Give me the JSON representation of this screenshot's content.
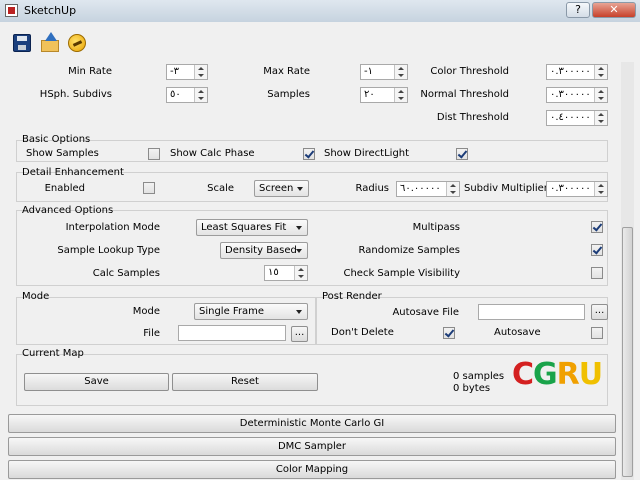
{
  "window": {
    "title": "SketchUp",
    "help_label": "?",
    "close_label": "✕"
  },
  "toolbar": {
    "save_icon": "save-icon",
    "open_icon": "open-folder-icon",
    "render_icon": "render-icon"
  },
  "top_params": {
    "min_rate_label": "Min Rate",
    "min_rate_value": "-٣",
    "max_rate_label": "Max Rate",
    "max_rate_value": "-١",
    "color_threshold_label": "Color Threshold",
    "color_threshold_value": "٠.٣٠٠٠٠٠",
    "hsph_label": "HSph. Subdivs",
    "hsph_value": "٥٠",
    "samples_label": "Samples",
    "samples_value": "٢٠",
    "normal_threshold_label": "Normal Threshold",
    "normal_threshold_value": "٠.٣٠٠٠٠٠",
    "dist_threshold_label": "Dist Threshold",
    "dist_threshold_value": "٠.٤٠٠٠٠٠"
  },
  "basic": {
    "title": "Basic Options",
    "show_samples_label": "Show Samples",
    "show_samples_checked": false,
    "show_calc_phase_label": "Show Calc Phase",
    "show_calc_phase_checked": true,
    "show_directlight_label": "Show DirectLight",
    "show_directlight_checked": true
  },
  "detail": {
    "title": "Detail Enhancement",
    "enabled_label": "Enabled",
    "enabled_checked": false,
    "scale_label": "Scale",
    "scale_value": "Screen",
    "radius_label": "Radius",
    "radius_value": "٦٠.٠٠٠٠٠",
    "subdiv_mult_label": "Subdiv Multiplier",
    "subdiv_mult_value": "٠.٣٠٠٠٠٠"
  },
  "advanced": {
    "title": "Advanced Options",
    "interp_label": "Interpolation Mode",
    "interp_value": "Least Squares Fit",
    "lookup_label": "Sample Lookup Type",
    "lookup_value": "Density Based",
    "calc_samples_label": "Calc Samples",
    "calc_samples_value": "١٥",
    "multipass_label": "Multipass",
    "multipass_checked": true,
    "randomize_label": "Randomize Samples",
    "randomize_checked": true,
    "check_vis_label": "Check Sample Visibility",
    "check_vis_checked": false
  },
  "mode": {
    "title": "Mode",
    "mode_label": "Mode",
    "mode_value": "Single Frame",
    "file_label": "File",
    "file_value": "",
    "browse_label": "..."
  },
  "post_render": {
    "title": "Post Render",
    "autosave_file_label": "Autosave File",
    "autosave_file_value": "",
    "browse_label": "...",
    "dont_delete_label": "Don't Delete",
    "dont_delete_checked": true,
    "autosave_label": "Autosave",
    "autosave_checked": false
  },
  "current_map": {
    "title": "Current Map",
    "save_label": "Save",
    "reset_label": "Reset",
    "samples_text": "0 samples",
    "bytes_text": "0 bytes",
    "logo_text": "CGRU"
  },
  "sections": [
    "Deterministic Monte Carlo GI",
    "DMC Sampler",
    "Color Mapping"
  ],
  "colors": {
    "logo_c": "#d42020",
    "logo_g": "#19a34a",
    "logo_r": "#f0a000",
    "logo_u": "#f0c000"
  }
}
